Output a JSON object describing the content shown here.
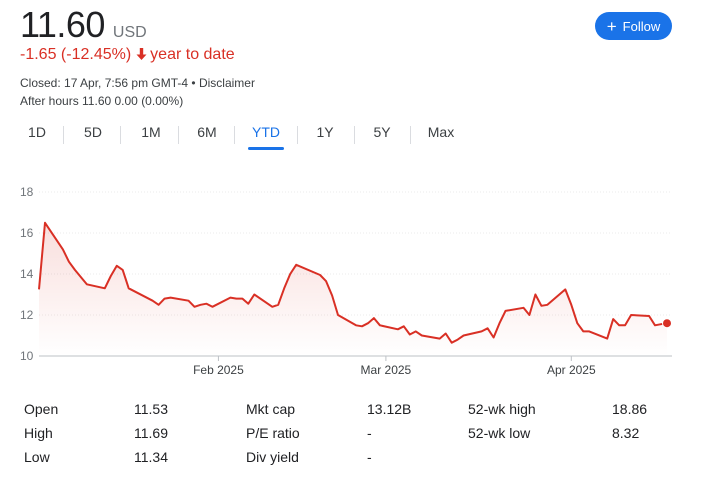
{
  "quote": {
    "price": "11.60",
    "currency": "USD",
    "change": "-1.65 (-12.45%)",
    "change_arrow": "arrow-down-icon",
    "period": "year to date",
    "closed": "Closed: 17 Apr, 7:56 pm GMT-4 • Disclaimer",
    "after_hours": "After hours 11.60 0.00 (0.00%)"
  },
  "follow": {
    "label": "Follow",
    "icon": "plus-icon",
    "color": "#1a73e8"
  },
  "tabs": [
    {
      "label": "1D"
    },
    {
      "label": "5D"
    },
    {
      "label": "1M"
    },
    {
      "label": "6M"
    },
    {
      "label": "YTD",
      "active": true
    },
    {
      "label": "1Y"
    },
    {
      "label": "5Y"
    },
    {
      "label": "Max"
    }
  ],
  "chart_data": {
    "type": "area",
    "title": "",
    "xlabel": "",
    "ylabel": "",
    "ylim": [
      10,
      18
    ],
    "y_ticks": [
      10,
      12,
      14,
      16,
      18
    ],
    "x_ticks": [
      {
        "label": "Feb 2025",
        "date": "2025-02-01"
      },
      {
        "label": "Mar 2025",
        "date": "2025-03-01"
      },
      {
        "label": "Apr 2025",
        "date": "2025-04-01"
      }
    ],
    "line_color": "#d93025",
    "grid": true,
    "x": [
      "2025-01-02",
      "2025-01-03",
      "2025-01-06",
      "2025-01-07",
      "2025-01-08",
      "2025-01-10",
      "2025-01-13",
      "2025-01-14",
      "2025-01-15",
      "2025-01-16",
      "2025-01-17",
      "2025-01-21",
      "2025-01-22",
      "2025-01-23",
      "2025-01-24",
      "2025-01-27",
      "2025-01-28",
      "2025-01-29",
      "2025-01-30",
      "2025-01-31",
      "2025-02-03",
      "2025-02-04",
      "2025-02-05",
      "2025-02-06",
      "2025-02-07",
      "2025-02-10",
      "2025-02-11",
      "2025-02-12",
      "2025-02-13",
      "2025-02-14",
      "2025-02-18",
      "2025-02-19",
      "2025-02-20",
      "2025-02-21",
      "2025-02-24",
      "2025-02-25",
      "2025-02-26",
      "2025-02-27",
      "2025-02-28",
      "2025-03-03",
      "2025-03-04",
      "2025-03-05",
      "2025-03-06",
      "2025-03-07",
      "2025-03-10",
      "2025-03-11",
      "2025-03-12",
      "2025-03-13",
      "2025-03-14",
      "2025-03-17",
      "2025-03-18",
      "2025-03-19",
      "2025-03-20",
      "2025-03-21",
      "2025-03-24",
      "2025-03-25",
      "2025-03-26",
      "2025-03-27",
      "2025-03-28",
      "2025-03-31",
      "2025-04-01",
      "2025-04-02",
      "2025-04-03",
      "2025-04-04",
      "2025-04-07",
      "2025-04-08",
      "2025-04-09",
      "2025-04-10",
      "2025-04-11",
      "2025-04-14",
      "2025-04-15",
      "2025-04-16",
      "2025-04-17"
    ],
    "series": [
      {
        "values": [
          13.25,
          16.5,
          15.2,
          14.6,
          14.2,
          13.5,
          13.3,
          13.9,
          14.4,
          14.2,
          13.3,
          12.7,
          12.5,
          12.8,
          12.85,
          12.7,
          12.4,
          12.5,
          12.55,
          12.4,
          12.85,
          12.8,
          12.8,
          12.55,
          13.0,
          12.4,
          12.5,
          13.3,
          14.0,
          14.45,
          13.95,
          13.65,
          12.95,
          12.0,
          11.5,
          11.45,
          11.6,
          11.85,
          11.5,
          11.3,
          11.45,
          11.05,
          11.2,
          11.0,
          10.85,
          11.1,
          10.65,
          10.8,
          11.0,
          11.2,
          11.35,
          10.9,
          11.6,
          12.2,
          12.35,
          12.0,
          13.0,
          12.45,
          12.5,
          13.25,
          12.5,
          11.6,
          11.2,
          11.2,
          10.85,
          11.8,
          11.5,
          11.5,
          12.0,
          11.95,
          11.5,
          11.55,
          11.6
        ]
      }
    ]
  },
  "stats": [
    {
      "label": "Open",
      "value": "11.53"
    },
    {
      "label": "High",
      "value": "11.69"
    },
    {
      "label": "Low",
      "value": "11.34"
    },
    {
      "label": "Mkt cap",
      "value": "13.12B"
    },
    {
      "label": "P/E ratio",
      "value": "-"
    },
    {
      "label": "Div yield",
      "value": "-"
    },
    {
      "label": "52-wk high",
      "value": "18.86"
    },
    {
      "label": "52-wk low",
      "value": "8.32"
    }
  ]
}
